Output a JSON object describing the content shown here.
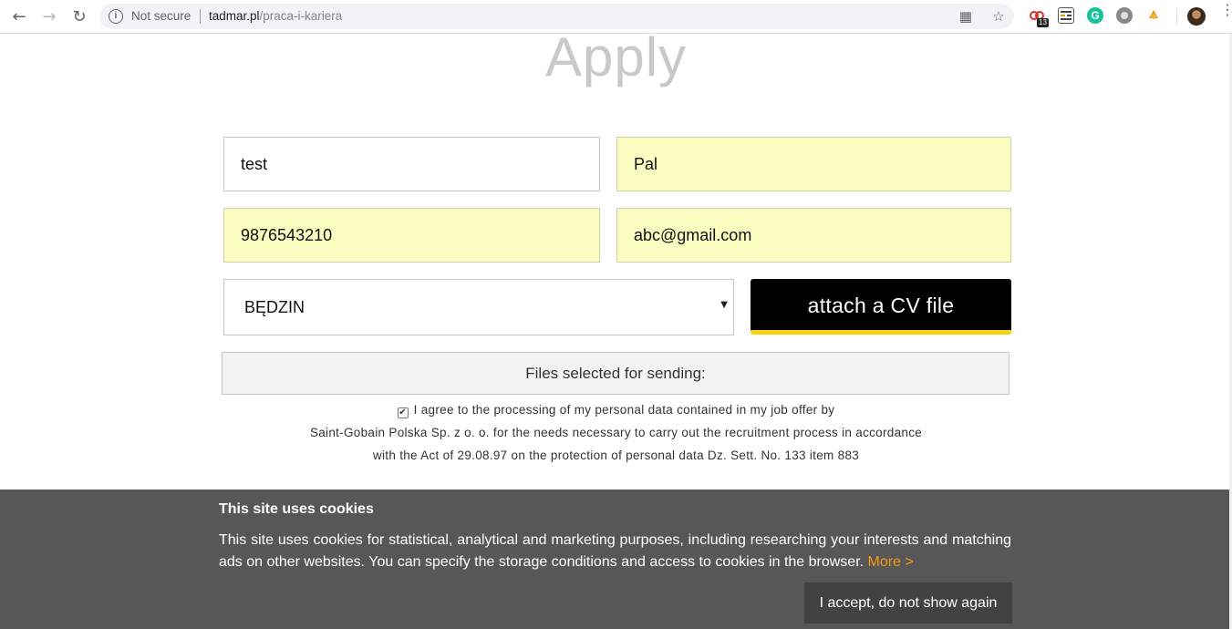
{
  "browser": {
    "security_label": "Not secure",
    "url_host": "tadmar.pl",
    "url_path": "/praca-i-kariera",
    "extension_badge": "13"
  },
  "page": {
    "title": "Apply",
    "form": {
      "first_name": "test",
      "last_name": "Pal",
      "phone": "9876543210",
      "email": "abc@gmail.com",
      "location": "BĘDZIN",
      "attach_label": "attach a CV file",
      "files_label": "Files selected for sending:",
      "consent_checked": true,
      "consent_lines": [
        "I agree to the processing of my personal data contained in my job offer by",
        "Saint-Gobain Polska Sp. z o. o. for the needs necessary to carry out the recruitment process in accordance",
        "with the Act of 29.08.97 on the protection of personal data Dz. Sett. No. 133 item 883"
      ]
    }
  },
  "cookie_banner": {
    "title": "This site uses cookies",
    "text": "This site uses cookies for statistical, analytical and marketing purposes, including researching your interests and matching ads on other websites. You can specify the storage conditions and access to cookies in the browser.",
    "more_label": "More >",
    "accept_label": "I accept, do not show again"
  },
  "colors": {
    "autofill": "#fafcc0",
    "accent_yellow": "#f5d40f",
    "cookie_bg": "#575757",
    "more_link": "#f39c12"
  }
}
